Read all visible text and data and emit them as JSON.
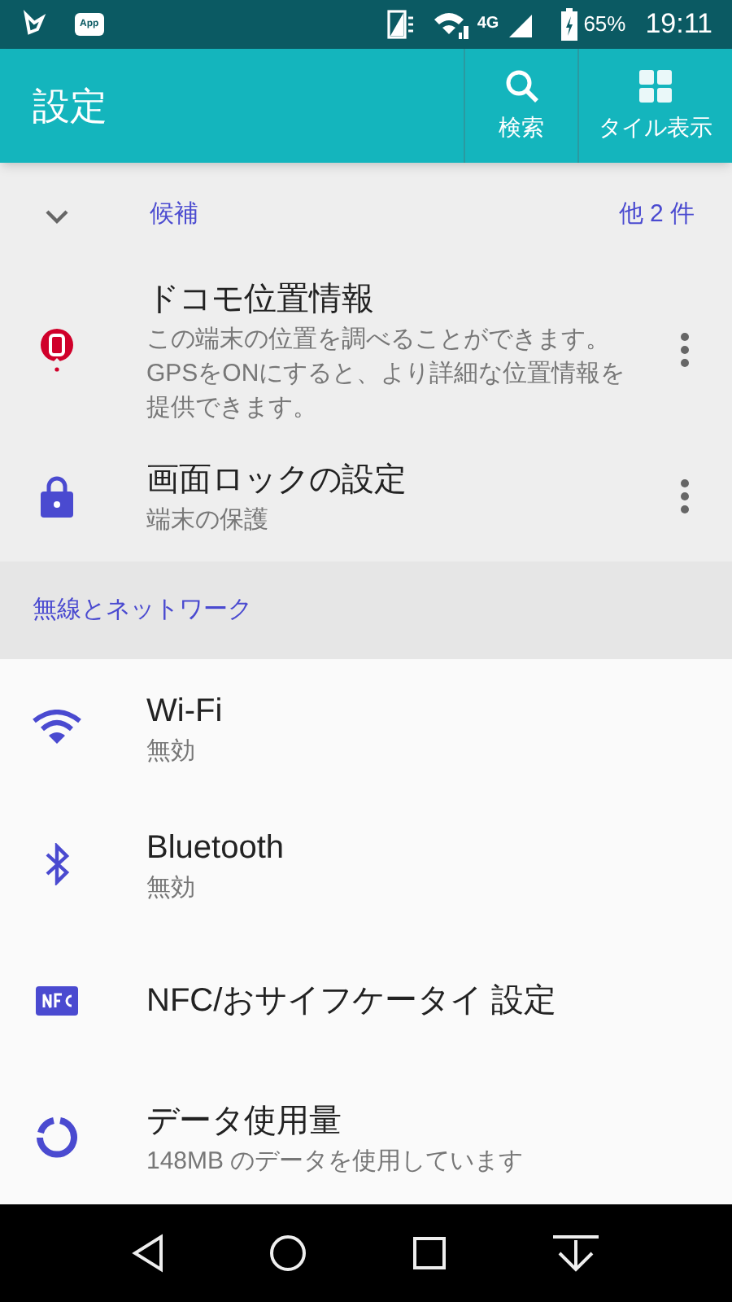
{
  "status_bar": {
    "app_badge": "App",
    "network": "4G",
    "battery": "65%",
    "time": "19:11"
  },
  "app_bar": {
    "title": "設定",
    "actions": [
      {
        "kind": "search",
        "label": "検索"
      },
      {
        "kind": "tiles",
        "label": "タイル表示"
      }
    ]
  },
  "suggestions": {
    "header": "候補",
    "more": "他 2 件",
    "items": [
      {
        "kind": "docomo-pin",
        "title": "ドコモ位置情報",
        "summary": "この端末の位置を調べることができます。GPSをONにすると、より詳細な位置情報を提供できます。"
      },
      {
        "kind": "lock",
        "title": "画面ロックの設定",
        "summary": "端末の保護"
      }
    ]
  },
  "section": {
    "header": "無線とネットワーク",
    "items": [
      {
        "kind": "wifi",
        "title": "Wi-Fi",
        "summary": "無効"
      },
      {
        "kind": "bluetooth",
        "title": "Bluetooth",
        "summary": "無効"
      },
      {
        "kind": "nfc",
        "title": "NFC/おサイフケータイ 設定"
      },
      {
        "kind": "data-usage",
        "title": "データ使用量",
        "summary": "148MB のデータを使用しています"
      }
    ]
  }
}
